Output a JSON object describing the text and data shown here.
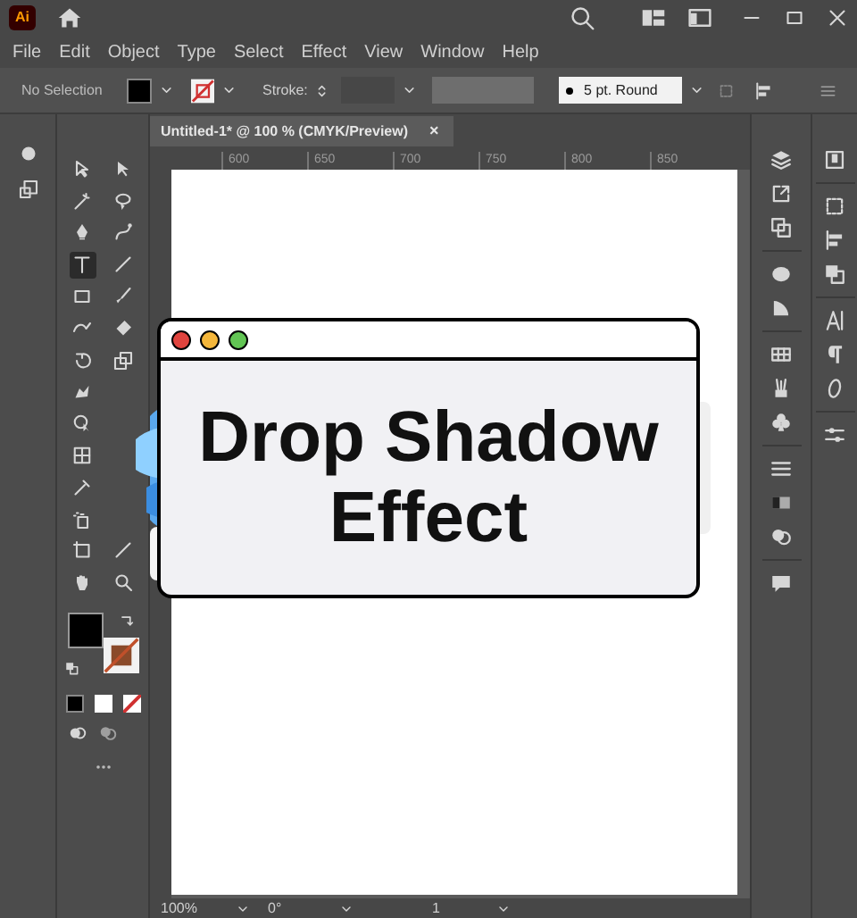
{
  "app": {
    "logo": "Ai"
  },
  "menu": [
    "File",
    "Edit",
    "Object",
    "Type",
    "Select",
    "Effect",
    "View",
    "Window",
    "Help"
  ],
  "control_bar": {
    "selection": "No Selection",
    "stroke_label": "Stroke:",
    "brush": "5 pt. Round"
  },
  "document_tab": {
    "title": "Untitled-1* @ 100 % (CMYK/Preview)",
    "close": "×"
  },
  "ruler_marks": [
    "600",
    "650",
    "700",
    "750",
    "800",
    "850"
  ],
  "tools": [
    {
      "selected": false
    },
    {
      "selected": false
    },
    {
      "selected": false
    },
    {
      "selected": false
    },
    {
      "selected": false
    },
    {
      "selected": false
    },
    {
      "selected": true
    },
    {
      "selected": false
    },
    {
      "selected": false
    },
    {
      "selected": false
    },
    {
      "selected": false
    },
    {
      "selected": false
    },
    {
      "selected": false
    },
    {
      "selected": false
    },
    {
      "selected": false
    },
    {
      "selected": false
    },
    {
      "selected": false
    },
    {
      "selected": false
    },
    {
      "selected": false
    },
    {
      "selected": false
    },
    {
      "selected": false
    },
    {
      "selected": false
    },
    {
      "selected": false
    }
  ],
  "graphic": {
    "heading": "Drop Shadow Effect",
    "dots": [
      {
        "color": "#e0443e"
      },
      {
        "color": "#f5b73b"
      },
      {
        "color": "#62c554"
      }
    ]
  },
  "status_bar": {
    "zoom": "100%",
    "rotation": "0°",
    "artboard": "1"
  }
}
